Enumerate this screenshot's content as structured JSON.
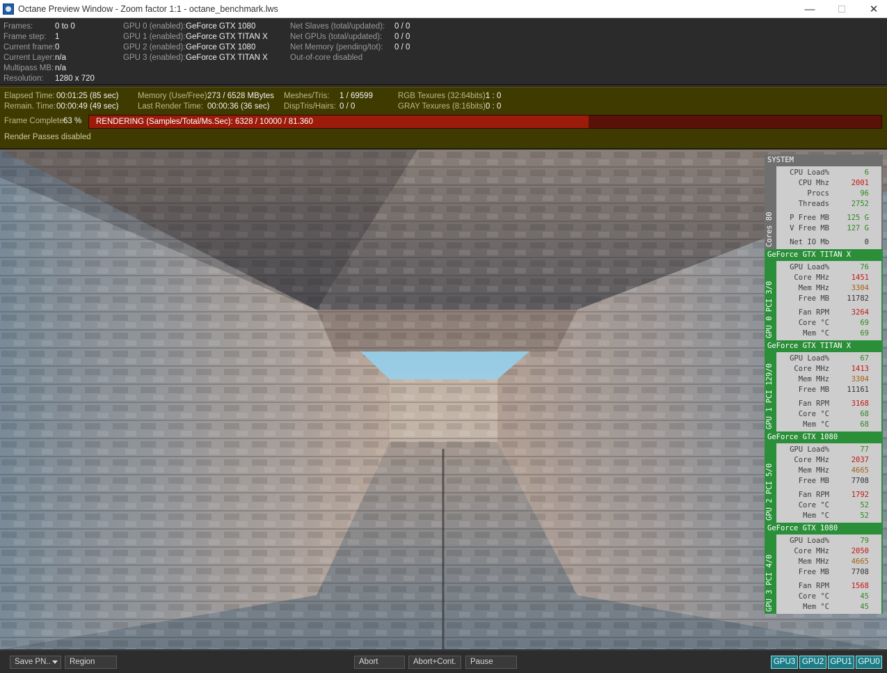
{
  "window": {
    "title": "Octane Preview Window - Zoom factor 1:1 - octane_benchmark.lws",
    "minimize": "—",
    "close": "✕"
  },
  "info": {
    "left": [
      {
        "label": "Frames:",
        "value": "0 to 0"
      },
      {
        "label": "Frame step:",
        "value": "1"
      },
      {
        "label": "Current frame:",
        "value": "0"
      },
      {
        "label": "Current Layer:",
        "value": "n/a"
      },
      {
        "label": "Multipass MB:",
        "value": "n/a"
      },
      {
        "label": "Resolution:",
        "value": "1280 x 720"
      }
    ],
    "gpus": [
      {
        "label": "GPU  0 (enabled):",
        "value": "GeForce GTX 1080"
      },
      {
        "label": "GPU  1 (enabled):",
        "value": "GeForce GTX TITAN X"
      },
      {
        "label": "GPU  2 (enabled):",
        "value": "GeForce GTX 1080"
      },
      {
        "label": "GPU  3 (enabled):",
        "value": "GeForce GTX TITAN X"
      }
    ],
    "net": [
      {
        "label": "Net Slaves (total/updated):",
        "value": "0 / 0"
      },
      {
        "label": "Net GPUs (total/updated):",
        "value": "0 / 0"
      },
      {
        "label": "Net Memory (pending/tot):",
        "value": "0 / 0"
      },
      {
        "label": "Out-of-core disabled",
        "value": ""
      }
    ]
  },
  "status": {
    "elapsed_label": "Elapsed Time:",
    "elapsed_value": "00:01:25 (85 sec)",
    "remain_label": "Remain. Time:",
    "remain_value": "00:00:49 (49 sec)",
    "memory_label": "Memory (Use/Free):",
    "memory_value": "273 / 6528 MBytes",
    "last_render_label": "Last Render Time:",
    "last_render_value": "00:00:36 (36 sec)",
    "meshes_label": "Meshes/Tris:",
    "meshes_value": "1 / 69599",
    "disptris_label": "DispTris/Hairs:",
    "disptris_value": "0 / 0",
    "rgb_label": "RGB Texures (32:64bits):",
    "rgb_value": "1 : 0",
    "gray_label": "GRAY Texures (8:16bits):",
    "gray_value": "0 : 0",
    "frame_complete_label": "Frame Complete:",
    "frame_complete_value": "63 %",
    "progress_fraction": 0.63,
    "rendering_text": "RENDERING (Samples/Total/Ms.Sec): 6328 / 10000 / 81.360",
    "render_passes": "Render Passes disabled"
  },
  "system": {
    "header": "SYSTEM",
    "side_label": "Cores 80",
    "rows": [
      {
        "label": "CPU Load%",
        "value": "6",
        "color": "green"
      },
      {
        "label": "CPU Mhz",
        "value": "2001",
        "color": "red"
      },
      {
        "label": "Procs",
        "value": "96",
        "color": "green"
      },
      {
        "label": "Threads",
        "value": "2752",
        "color": "green"
      },
      {
        "label": "P Free MB",
        "value": "125 G",
        "color": "green",
        "gap": true
      },
      {
        "label": "V Free MB",
        "value": "127 G",
        "color": "green"
      },
      {
        "label": "Net IO Mb",
        "value": "0",
        "color": "dark",
        "gap": true
      }
    ]
  },
  "gpu_blocks": [
    {
      "header": "GeForce GTX TITAN X",
      "side_label": "GPU 0 PCI 3/0",
      "load": "76",
      "core_mhz": "1451",
      "mem_mhz": "3304",
      "free_mb": "11782",
      "fan_rpm": "3264",
      "core_c": "69",
      "mem_c": "69"
    },
    {
      "header": "GeForce GTX TITAN X",
      "side_label": "GPU 1 PCI 129/0",
      "load": "67",
      "core_mhz": "1413",
      "mem_mhz": "3304",
      "free_mb": "11161",
      "fan_rpm": "3168",
      "core_c": "68",
      "mem_c": "68"
    },
    {
      "header": "GeForce GTX 1080",
      "side_label": "GPU 2 PCI 5/0",
      "load": "77",
      "core_mhz": "2037",
      "mem_mhz": "4665",
      "free_mb": "7708",
      "fan_rpm": "1792",
      "core_c": "52",
      "mem_c": "52"
    },
    {
      "header": "GeForce GTX 1080",
      "side_label": "GPU 3 PCI 4/0",
      "load": "79",
      "core_mhz": "2050",
      "mem_mhz": "4665",
      "free_mb": "7708",
      "fan_rpm": "1568",
      "core_c": "45",
      "mem_c": "45"
    }
  ],
  "gpu_row_labels": {
    "load": "GPU Load%",
    "core_mhz": "Core MHz",
    "mem_mhz": "Mem MHz",
    "free_mb": "Free MB",
    "fan_rpm": "Fan RPM",
    "core_c": "Core °C",
    "mem_c": "Mem °C"
  },
  "toolbar": {
    "save": "Save PN..",
    "region": "Region",
    "abort": "Abort",
    "abort_cont": "Abort+Cont.",
    "pause": "Pause",
    "gpu_buttons": [
      "GPU3",
      "GPU2",
      "GPU1",
      "GPU0"
    ]
  }
}
